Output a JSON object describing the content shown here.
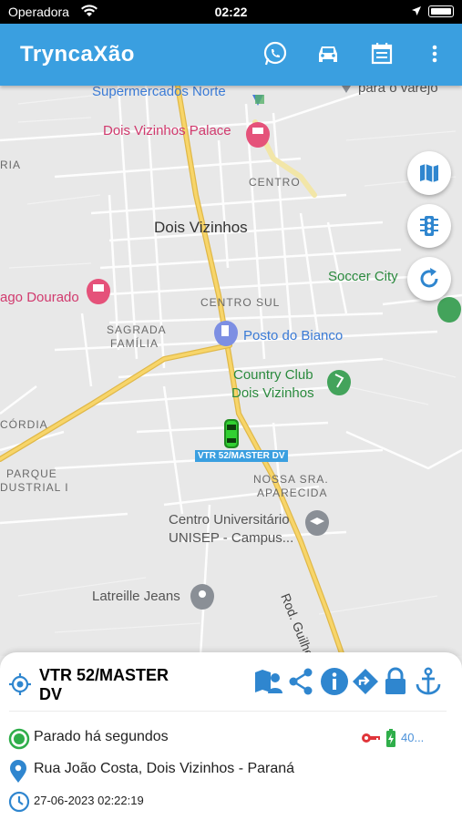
{
  "status_bar": {
    "carrier": "Operadora",
    "time": "02:22"
  },
  "app_bar": {
    "title": "TryncaXão"
  },
  "map": {
    "labels": {
      "supermercados": "Supermercados Norte",
      "para_varejo": "para o varejo",
      "palace": "Dois Vizinhos Palace",
      "centro": "CENTRO",
      "ria": "RIA",
      "dois_vizinhos": "Dois Vizinhos",
      "soccer_city": "Soccer City",
      "lago_dourado": "ago Dourado",
      "centro_sul": "CENTRO SUL",
      "sagrada_1": "SAGRADA",
      "sagrada_2": "FAMÍLIA",
      "posto": "Posto do Bianco",
      "country_1": "Country Club",
      "country_2": "Dois Vizinhos",
      "cordia": "CÓRDIA",
      "parque_1": "PARQUE",
      "parque_2": "DUSTRIAL I",
      "nossa_1": "NOSSA SRA.",
      "nossa_2": "APARECIDA",
      "centro_univ_1": "Centro Universitário",
      "centro_univ_2": "UNISEP - Campus...",
      "latreille": "Latreille Jeans",
      "rod_guilherme": "Rod. Guilherme Ka"
    },
    "vehicle_tag": "VTR 52/MASTER DV"
  },
  "panel": {
    "vehicle_name": "VTR 52/MASTER DV",
    "status_text": "Parado há segundos",
    "battery_text": "40...",
    "address": "Rua João Costa, Dois Vizinhos - Paraná",
    "timestamp": "27-06-2023 02:22:19"
  },
  "colors": {
    "app_bar": "#3a9fe0",
    "icon_blue": "#2f86cf",
    "status_green": "#2fae4a",
    "key_red": "#e0353a"
  }
}
